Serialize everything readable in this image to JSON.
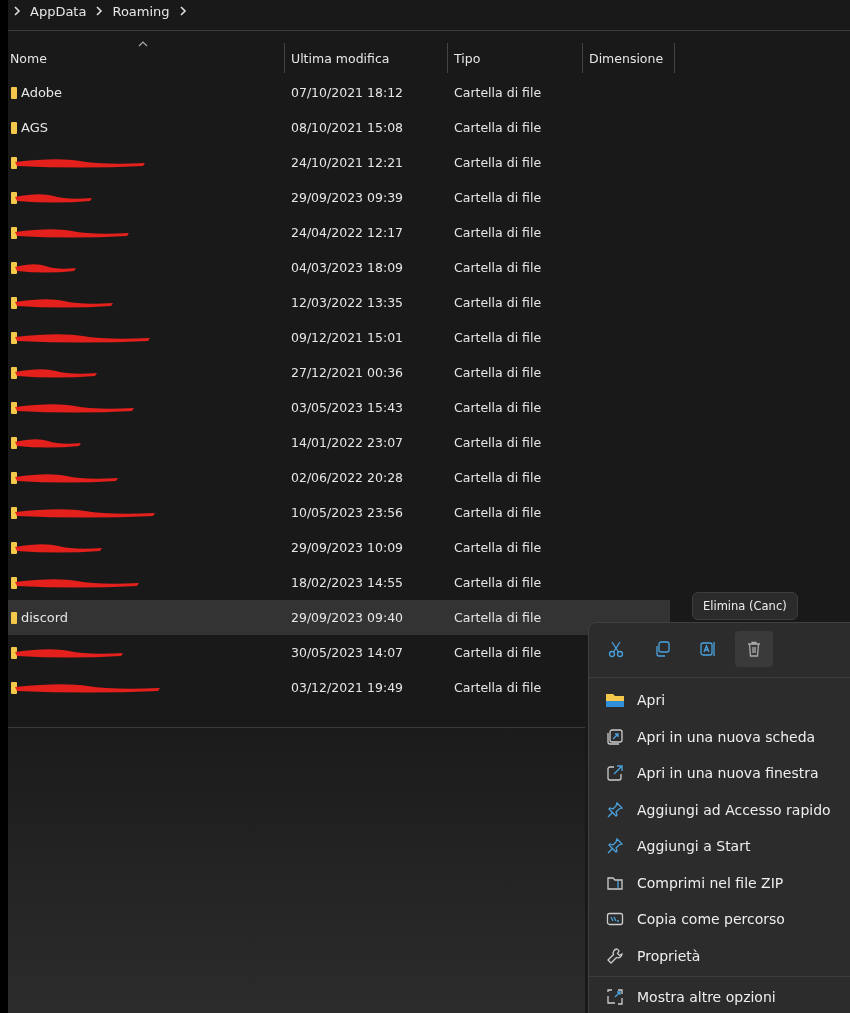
{
  "breadcrumb": [
    "AppData",
    "Roaming"
  ],
  "table": {
    "columns": [
      {
        "label": "Nome",
        "sorted": true
      },
      {
        "label": "Ultima modifica",
        "sorted": false
      },
      {
        "label": "Tipo",
        "sorted": false
      },
      {
        "label": "Dimensione",
        "sorted": false
      }
    ],
    "rows": [
      {
        "name": "Adobe",
        "redacted": false,
        "modified": "07/10/2021 18:12",
        "type": "Cartella di file",
        "selected": false
      },
      {
        "name": "AGS",
        "redacted": false,
        "modified": "08/10/2021 15:08",
        "type": "Cartella di file",
        "selected": false
      },
      {
        "redacted": true,
        "modified": "24/10/2021 12:21",
        "type": "Cartella di file",
        "selected": false
      },
      {
        "redacted": true,
        "modified": "29/09/2023 09:39",
        "type": "Cartella di file",
        "selected": false
      },
      {
        "redacted": true,
        "modified": "24/04/2022 12:17",
        "type": "Cartella di file",
        "selected": false
      },
      {
        "redacted": true,
        "modified": "04/03/2023 18:09",
        "type": "Cartella di file",
        "selected": false
      },
      {
        "redacted": true,
        "modified": "12/03/2022 13:35",
        "type": "Cartella di file",
        "selected": false
      },
      {
        "redacted": true,
        "modified": "09/12/2021 15:01",
        "type": "Cartella di file",
        "selected": false
      },
      {
        "redacted": true,
        "modified": "27/12/2021 00:36",
        "type": "Cartella di file",
        "selected": false
      },
      {
        "redacted": true,
        "modified": "03/05/2023 15:43",
        "type": "Cartella di file",
        "selected": false
      },
      {
        "redacted": true,
        "modified": "14/01/2022 23:07",
        "type": "Cartella di file",
        "selected": false
      },
      {
        "redacted": true,
        "modified": "02/06/2022 20:28",
        "type": "Cartella di file",
        "selected": false
      },
      {
        "redacted": true,
        "modified": "10/05/2023 23:56",
        "type": "Cartella di file",
        "selected": false
      },
      {
        "redacted": true,
        "modified": "29/09/2023 10:09",
        "type": "Cartella di file",
        "selected": false
      },
      {
        "redacted": true,
        "modified": "18/02/2023 14:55",
        "type": "Cartella di file",
        "selected": false
      },
      {
        "name": "discord",
        "redacted": false,
        "modified": "29/09/2023 09:40",
        "type": "Cartella di file",
        "selected": true
      },
      {
        "redacted": true,
        "modified": "30/05/2023 14:07",
        "type": "Cartella di file",
        "selected": false
      },
      {
        "redacted": true,
        "modified": "03/12/2021 19:49",
        "type": "Cartella di file",
        "selected": false
      }
    ]
  },
  "context_menu": {
    "tooltip": "Elimina (Canc)",
    "quick_actions": [
      {
        "hovered": false
      },
      {
        "hovered": false
      },
      {
        "hovered": false
      },
      {
        "hovered": true
      }
    ],
    "items": [
      {
        "label": "Apri"
      },
      {
        "label": "Apri in una nuova scheda"
      },
      {
        "label": "Apri in una nuova finestra"
      },
      {
        "label": "Aggiungi ad Accesso rapido"
      },
      {
        "label": "Aggiungi a Start"
      },
      {
        "label": "Comprimi nel file ZIP"
      },
      {
        "label": "Copia come percorso"
      },
      {
        "label": "Proprietà"
      },
      {
        "label": "Mostra altre opzioni"
      }
    ]
  }
}
